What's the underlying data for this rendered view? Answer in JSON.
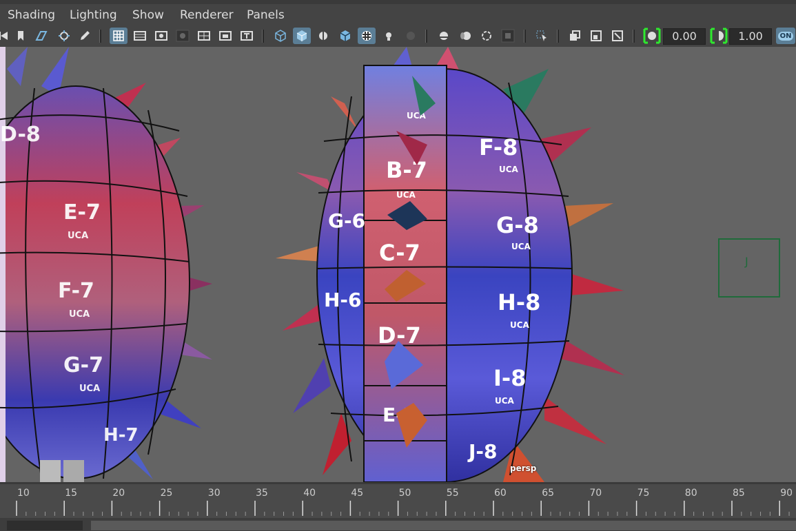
{
  "menu": {
    "items": [
      "Shading",
      "Lighting",
      "Show",
      "Renderer",
      "Panels"
    ]
  },
  "toolbar": {
    "icons": [
      "camera-select-icon",
      "bookmark-icon",
      "image-plane-icon",
      "camera-tumble-icon",
      "grease-pencil-icon",
      "grid-icon",
      "film-gate-icon",
      "resolution-gate-icon",
      "gate-mask-icon",
      "field-chart-icon",
      "safe-action-icon",
      "safe-title-icon",
      "wireframe-icon",
      "smooth-shade-icon",
      "default-lighting-icon",
      "wireframe-on-shaded-icon",
      "textured-icon",
      "use-all-lights-icon",
      "shadows-icon",
      "screen-space-ao-icon",
      "motion-blur-icon",
      "anti-aliasing-icon",
      "depth-of-field-icon",
      "isolate-select-icon",
      "xray-icon",
      "xray-joints-icon",
      "xray-components-icon",
      "camera-attributes-icon"
    ],
    "exposure_value": "0.00",
    "gamma_value": "1.00",
    "color_manage_label": "ON"
  },
  "viewport": {
    "camera_label": "persp",
    "tiles_left": [
      "D-8",
      "E-7",
      "F-7",
      "G-7",
      "H-7"
    ],
    "tiles_center": [
      "B-7",
      "C-7",
      "D-7",
      "E-7",
      "F-8",
      "G-8",
      "H-8",
      "I-8",
      "J-8",
      "G-6",
      "H-6"
    ],
    "tile_sublabel": "UCA",
    "locator_label": "J"
  },
  "timeline": {
    "ticks": [
      "10",
      "15",
      "20",
      "25",
      "30",
      "35",
      "40",
      "45",
      "50",
      "55",
      "60",
      "65",
      "70",
      "75",
      "80",
      "85",
      "90"
    ]
  }
}
